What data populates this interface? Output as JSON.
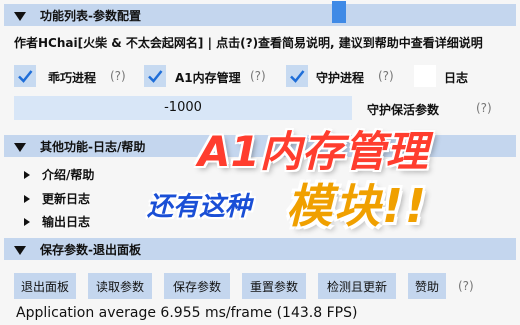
{
  "sections": {
    "config": "功能列表-参数配置",
    "other": "其他功能-日志/帮助",
    "save": "保存参数-退出面板"
  },
  "author_line": "作者HChai[火柴 & 不太会起网名] | 点击(?)查看简易说明, 建议到帮助中查看详细说明",
  "checkboxes": [
    {
      "label": "乖巧进程",
      "checked": true,
      "help": "(?)"
    },
    {
      "label": "A1内存管理",
      "checked": true,
      "help": "(?)"
    },
    {
      "label": "守护进程",
      "checked": true,
      "help": "(?)"
    },
    {
      "label": "日志",
      "checked": false,
      "help": ""
    }
  ],
  "slider": {
    "value": "-1000",
    "label": "守护保活参数",
    "help": "(?)"
  },
  "tree_items": [
    "介绍/帮助",
    "更新日志",
    "输出日志"
  ],
  "buttons": [
    "退出面板",
    "读取参数",
    "保存参数",
    "重置参数",
    "检测且更新",
    "赞助",
    "(?)"
  ],
  "fps_text": "Application average 6.955 ms/frame (143.8 FPS)",
  "overlay": {
    "line1": "A1内存管理",
    "line2": "还有这种",
    "line3": "模块!!"
  },
  "colors": {
    "header": "#c4d6ee",
    "accent": "#3f8ae6",
    "overlay_red": "#ff3d2e",
    "overlay_blue": "#1a4fd6",
    "overlay_orange": "#f0a000"
  }
}
